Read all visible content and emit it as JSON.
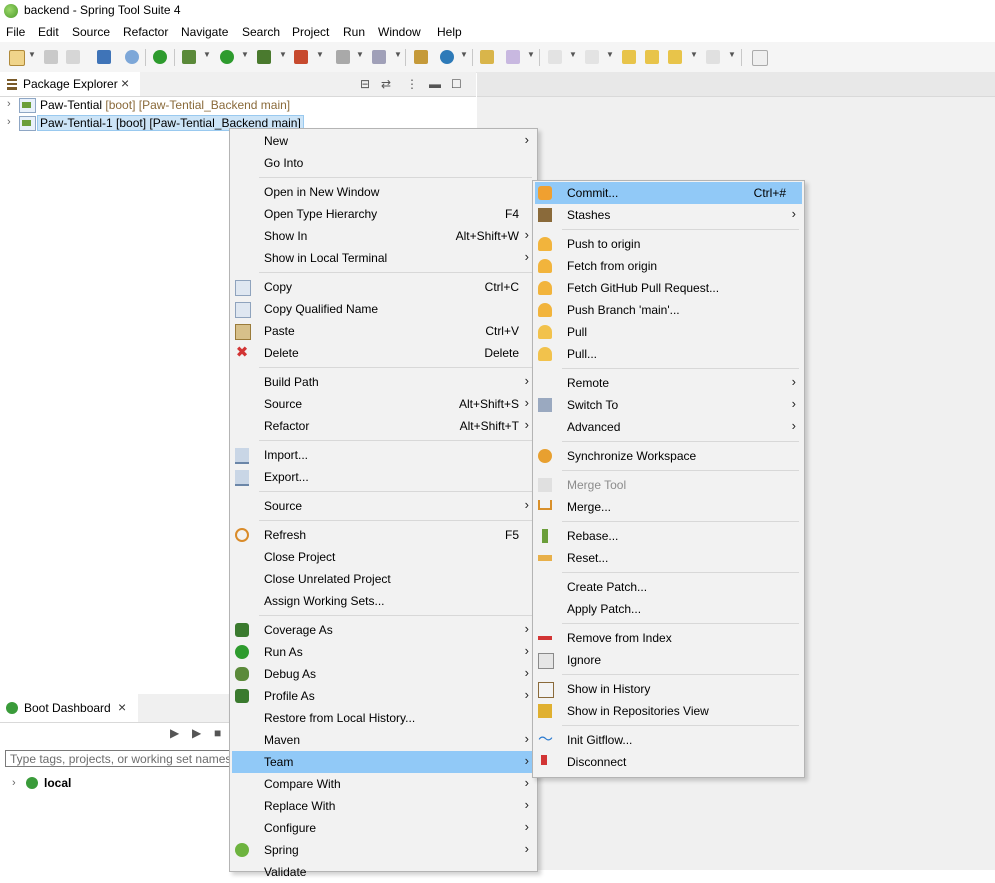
{
  "window": {
    "title": "backend - Spring Tool Suite 4"
  },
  "menubar": [
    "File",
    "Edit",
    "Source",
    "Refactor",
    "Navigate",
    "Search",
    "Project",
    "Run",
    "Window",
    "Help"
  ],
  "package_explorer": {
    "tab_label": "Package Explorer",
    "projects": [
      {
        "name": "Paw-Tential",
        "decoration": "[boot] [Paw-Tential_Backend main]",
        "selected": false
      },
      {
        "name": "Paw-Tential-1",
        "decoration": "[boot] [Paw-Tential_Backend main]",
        "selected": true
      }
    ]
  },
  "boot_dashboard": {
    "tab_label": "Boot Dashboard",
    "filter_placeholder": "Type tags, projects, or working set names",
    "local_label": "local"
  },
  "context_menu": {
    "items": [
      {
        "label": "New",
        "submenu": true
      },
      {
        "label": "Go Into"
      },
      {
        "sep": true
      },
      {
        "label": "Open in New Window"
      },
      {
        "label": "Open Type Hierarchy",
        "accel": "F4"
      },
      {
        "label": "Show In",
        "accel": "Alt+Shift+W",
        "submenu": true
      },
      {
        "label": "Show in Local Terminal",
        "submenu": true
      },
      {
        "sep": true
      },
      {
        "label": "Copy",
        "accel": "Ctrl+C",
        "icon": "copy-icon"
      },
      {
        "label": "Copy Qualified Name",
        "icon": "copy-qualified-icon"
      },
      {
        "label": "Paste",
        "accel": "Ctrl+V",
        "icon": "paste-icon"
      },
      {
        "label": "Delete",
        "accel": "Delete",
        "icon": "delete-icon"
      },
      {
        "sep": true
      },
      {
        "label": "Build Path",
        "submenu": true
      },
      {
        "label": "Source",
        "accel": "Alt+Shift+S",
        "submenu": true
      },
      {
        "label": "Refactor",
        "accel": "Alt+Shift+T",
        "submenu": true
      },
      {
        "sep": true
      },
      {
        "label": "Import...",
        "icon": "import-icon"
      },
      {
        "label": "Export...",
        "icon": "export-icon"
      },
      {
        "sep": true
      },
      {
        "label": "Source",
        "submenu": true
      },
      {
        "sep": true
      },
      {
        "label": "Refresh",
        "accel": "F5",
        "icon": "refresh-icon"
      },
      {
        "label": "Close Project"
      },
      {
        "label": "Close Unrelated Project"
      },
      {
        "label": "Assign Working Sets..."
      },
      {
        "sep": true
      },
      {
        "label": "Coverage As",
        "submenu": true,
        "icon": "coverage-icon"
      },
      {
        "label": "Run As",
        "submenu": true,
        "icon": "run-icon"
      },
      {
        "label": "Debug As",
        "submenu": true,
        "icon": "debug-icon"
      },
      {
        "label": "Profile As",
        "submenu": true,
        "icon": "profile-icon"
      },
      {
        "label": "Restore from Local History..."
      },
      {
        "label": "Maven",
        "submenu": true
      },
      {
        "label": "Team",
        "submenu": true,
        "highlighted": true
      },
      {
        "label": "Compare With",
        "submenu": true
      },
      {
        "label": "Replace With",
        "submenu": true
      },
      {
        "label": "Configure",
        "submenu": true
      },
      {
        "label": "Spring",
        "submenu": true,
        "icon": "spring-icon"
      },
      {
        "label": "Validate"
      }
    ]
  },
  "team_menu": {
    "items": [
      {
        "label": "Commit...",
        "accel": "Ctrl+#",
        "icon": "commit-icon",
        "highlighted": true
      },
      {
        "label": "Stashes",
        "submenu": true,
        "icon": "stashes-icon"
      },
      {
        "sep": true
      },
      {
        "label": "Push to origin",
        "icon": "push-icon"
      },
      {
        "label": "Fetch from origin",
        "icon": "fetch-icon"
      },
      {
        "label": "Fetch GitHub Pull Request...",
        "icon": "fetch-pr-icon"
      },
      {
        "label": "Push Branch 'main'...",
        "icon": "push-branch-icon"
      },
      {
        "label": "Pull",
        "icon": "pull-icon"
      },
      {
        "label": "Pull...",
        "icon": "pull-dialog-icon"
      },
      {
        "sep": true
      },
      {
        "label": "Remote",
        "submenu": true
      },
      {
        "label": "Switch To",
        "submenu": true,
        "icon": "switch-branch-icon"
      },
      {
        "label": "Advanced",
        "submenu": true
      },
      {
        "sep": true
      },
      {
        "label": "Synchronize Workspace",
        "icon": "synchronize-icon"
      },
      {
        "sep": true
      },
      {
        "label": "Merge Tool",
        "icon": "merge-tool-icon",
        "disabled": true
      },
      {
        "label": "Merge...",
        "icon": "merge-icon"
      },
      {
        "sep": true
      },
      {
        "label": "Rebase...",
        "icon": "rebase-icon"
      },
      {
        "label": "Reset...",
        "icon": "reset-icon"
      },
      {
        "sep": true
      },
      {
        "label": "Create Patch..."
      },
      {
        "label": "Apply Patch..."
      },
      {
        "sep": true
      },
      {
        "label": "Remove from Index",
        "icon": "remove-index-icon"
      },
      {
        "label": "Ignore",
        "icon": "ignore-icon"
      },
      {
        "sep": true
      },
      {
        "label": "Show in History",
        "icon": "history-icon"
      },
      {
        "label": "Show in Repositories View",
        "icon": "repositories-icon"
      },
      {
        "sep": true
      },
      {
        "label": "Init Gitflow...",
        "icon": "gitflow-icon"
      },
      {
        "label": "Disconnect",
        "icon": "disconnect-icon"
      }
    ]
  },
  "colors": {
    "highlight": "#91c9f7",
    "menu_bg": "#f2f2f2",
    "selection": "#cce4f7"
  }
}
